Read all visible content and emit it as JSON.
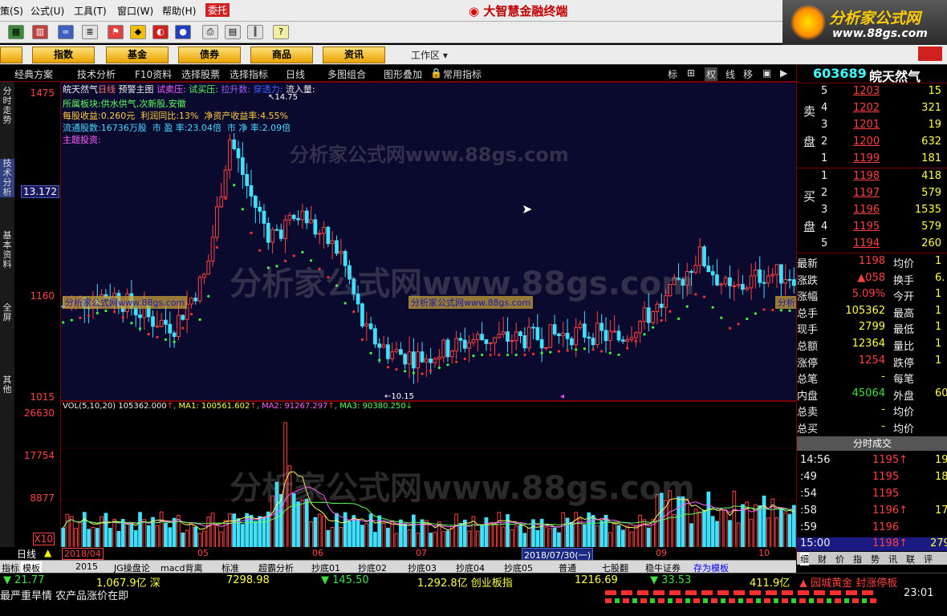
{
  "menu": {
    "items": [
      "策(S)",
      "公式(U)",
      "工具(T)",
      "窗口(W)",
      "帮助(H)"
    ],
    "trust_label": "委托",
    "app_title": "大智慧金融终端"
  },
  "logo": {
    "line1": "分析家公式网",
    "line2": "www.88gs.com"
  },
  "modules": [
    "指数",
    "基金",
    "债券",
    "商品",
    "资讯"
  ],
  "workarea_label": "工作区",
  "subbar": {
    "left": [
      "经典方案",
      "技术分析",
      "F10资料",
      "选择股票",
      "选择指标",
      "日线",
      "多图组合",
      "图形叠加",
      "常用指标"
    ],
    "right": [
      "标",
      "权",
      "线",
      "移"
    ]
  },
  "vtabs": [
    "分时走势",
    "技术分析",
    "基本资料",
    "全屏",
    "其他"
  ],
  "price_axis": {
    "labels": [
      "1475",
      "1160",
      "1015"
    ],
    "current": "13.172"
  },
  "vol_axis": {
    "labels": [
      "26630",
      "17754",
      "8877"
    ],
    "unit": "X10"
  },
  "chart_header": {
    "name": "皖天然气",
    "period": "日线",
    "indicator": "预警主图",
    "tags": [
      "试卖压:",
      "试买压:",
      "拉升数:",
      "穿透力:",
      "流入量:"
    ]
  },
  "stock_info": {
    "sector": "所属板块:供水供气,次新股,安徽",
    "eps": "每股收益:0.260元",
    "profit": "利润同比:13%",
    "roe": "净资产收益率:4.55%",
    "float": "流通股数:16736万股",
    "pe": "市 盈 率:23.04倍",
    "pb": "市 净 率:2.09倍",
    "theme": "主题投资:"
  },
  "annotations": {
    "high": "14.75",
    "low": "10.15"
  },
  "watermark": {
    "text": "分析家公式网www.88gs.com"
  },
  "vol_header": {
    "label": "VOL(5,10,20)",
    "value": "105362.000",
    "ma1": "MA1: 100561.602",
    "ma2": "MA2: 91267.297",
    "ma3": "MA3: 90380.250"
  },
  "dates": {
    "labels": [
      "2018/04",
      "05",
      "06",
      "07",
      "09",
      "10"
    ],
    "cursor": "2018/07/30(一)",
    "period": "日线"
  },
  "bottom_tabs": [
    "指标",
    "模板",
    "2015",
    "JG操盘论",
    "macd背离",
    "标准",
    "超霸分析",
    "抄底01",
    "抄底02",
    "抄底03",
    "抄底04",
    "抄底05",
    "普通",
    "七股翻",
    "稳牛证券",
    "存为模板"
  ],
  "quote": {
    "code": "603689",
    "name": "皖天然气",
    "sell": [
      {
        "lvl": "5",
        "price": "1203",
        "vol": "15"
      },
      {
        "lvl": "4",
        "price": "1202",
        "vol": "321"
      },
      {
        "lvl": "3",
        "price": "1201",
        "vol": "19"
      },
      {
        "lvl": "2",
        "price": "1200",
        "vol": "632"
      },
      {
        "lvl": "1",
        "price": "1199",
        "vol": "181"
      }
    ],
    "buy": [
      {
        "lvl": "1",
        "price": "1198",
        "vol": "418"
      },
      {
        "lvl": "2",
        "price": "1197",
        "vol": "579"
      },
      {
        "lvl": "3",
        "price": "1196",
        "vol": "1535"
      },
      {
        "lvl": "4",
        "price": "1195",
        "vol": "579"
      },
      {
        "lvl": "5",
        "price": "1194",
        "vol": "260"
      }
    ],
    "sell_side": [
      "卖",
      "盘"
    ],
    "buy_side": [
      "买",
      "盘"
    ],
    "stats": [
      [
        "最新",
        "1198",
        "均价",
        "1"
      ],
      [
        "涨跌",
        "▲058",
        "换手",
        "6."
      ],
      [
        "涨幅",
        "5.09%",
        "今开",
        "1"
      ],
      [
        "总手",
        "105362",
        "最高",
        "1"
      ],
      [
        "现手",
        "2799",
        "最低",
        "1"
      ],
      [
        "总额",
        "12364",
        "量比",
        "1"
      ],
      [
        "涨停",
        "1254",
        "跌停",
        "1"
      ],
      [
        "总笔",
        "-",
        "每笔",
        ""
      ],
      [
        "内盘",
        "45064",
        "外盘",
        "60"
      ],
      [
        "总卖",
        "-",
        "均价",
        ""
      ],
      [
        "总买",
        "-",
        "均价",
        ""
      ]
    ],
    "ticks_title": "分时成交",
    "ticks": [
      [
        "14:56",
        "1195↑",
        "19"
      ],
      [
        ":49",
        "1195",
        "18"
      ],
      [
        ":54",
        "1195",
        ""
      ],
      [
        ":58",
        "1196↑",
        "17"
      ],
      [
        ":59",
        "1196",
        ""
      ]
    ],
    "last_tick": [
      "15:00",
      "1198↑",
      "279"
    ],
    "tabs": [
      "细",
      "财",
      "价",
      "指",
      "势",
      "讯",
      "联",
      "评"
    ]
  },
  "status": {
    "line1": [
      "▼ 21.77",
      "1,067.9亿 深",
      "7298.98",
      "▼ 145.50",
      "1,292.8亿 创业板指",
      "1216.69",
      "▼ 33.53",
      "411.9亿",
      "▲ 园城黄金 封涨停板"
    ],
    "line2": [
      "最严重旱情 农产品涨价在即",
      "23:01"
    ]
  },
  "chart_data": {
    "type": "candlestick",
    "price_axis_ticks": [
      14.75,
      11.6,
      10.15
    ],
    "high_label": 14.75,
    "low_label": 10.15,
    "volume_axis_ticks": [
      26630,
      17754,
      8877
    ],
    "note": "candle and volume series shown are approximate reconstruction of the visible pattern"
  }
}
